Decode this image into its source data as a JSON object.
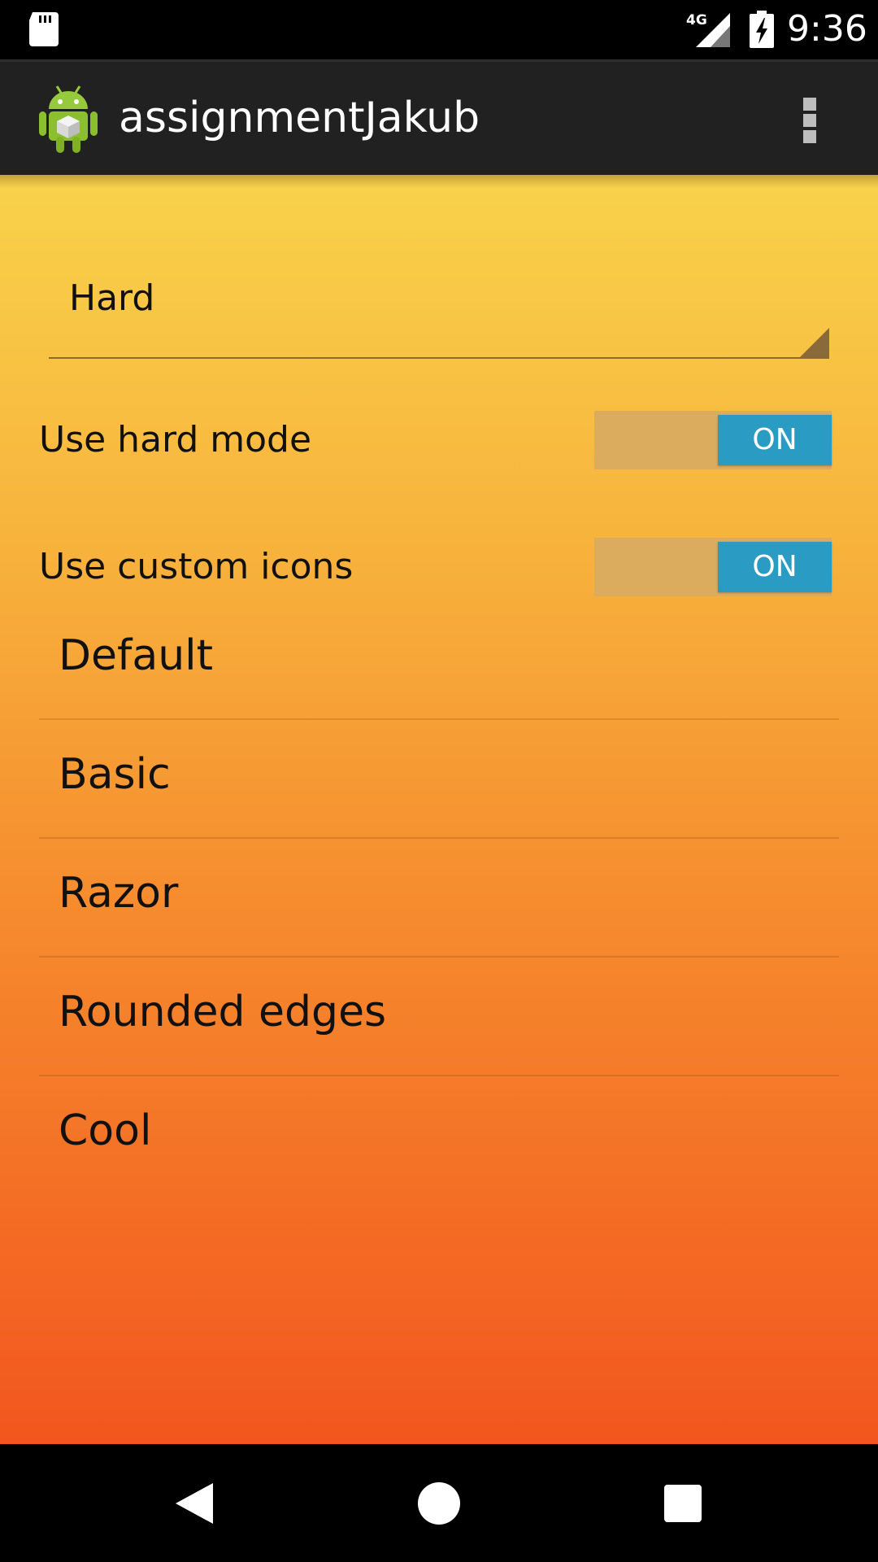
{
  "status_bar": {
    "time": "9:36",
    "network_label": "4G",
    "icons": [
      "sd-card-icon",
      "signal-icon",
      "battery-charging-icon"
    ]
  },
  "action_bar": {
    "title": "assignmentJakub",
    "logo_icon": "android-logo-icon",
    "overflow_icon": "overflow-menu-icon"
  },
  "difficulty_spinner": {
    "selected": "Hard"
  },
  "settings": {
    "hard_mode": {
      "label": "Use hard mode",
      "state": "ON"
    },
    "custom_icons": {
      "label": "Use custom icons",
      "state": "ON"
    }
  },
  "icon_list": {
    "items": [
      {
        "label": "Default"
      },
      {
        "label": "Basic"
      },
      {
        "label": "Razor"
      },
      {
        "label": "Rounded edges"
      },
      {
        "label": "Cool"
      }
    ]
  },
  "nav_bar": {
    "icons": [
      "back-icon",
      "home-icon",
      "recents-icon"
    ]
  },
  "colors": {
    "gradient_top": "#f9d24a",
    "gradient_bottom": "#f2561e",
    "switch_on": "#2a9cc4",
    "switch_track": "#dbab5e",
    "action_bar": "#212121"
  }
}
